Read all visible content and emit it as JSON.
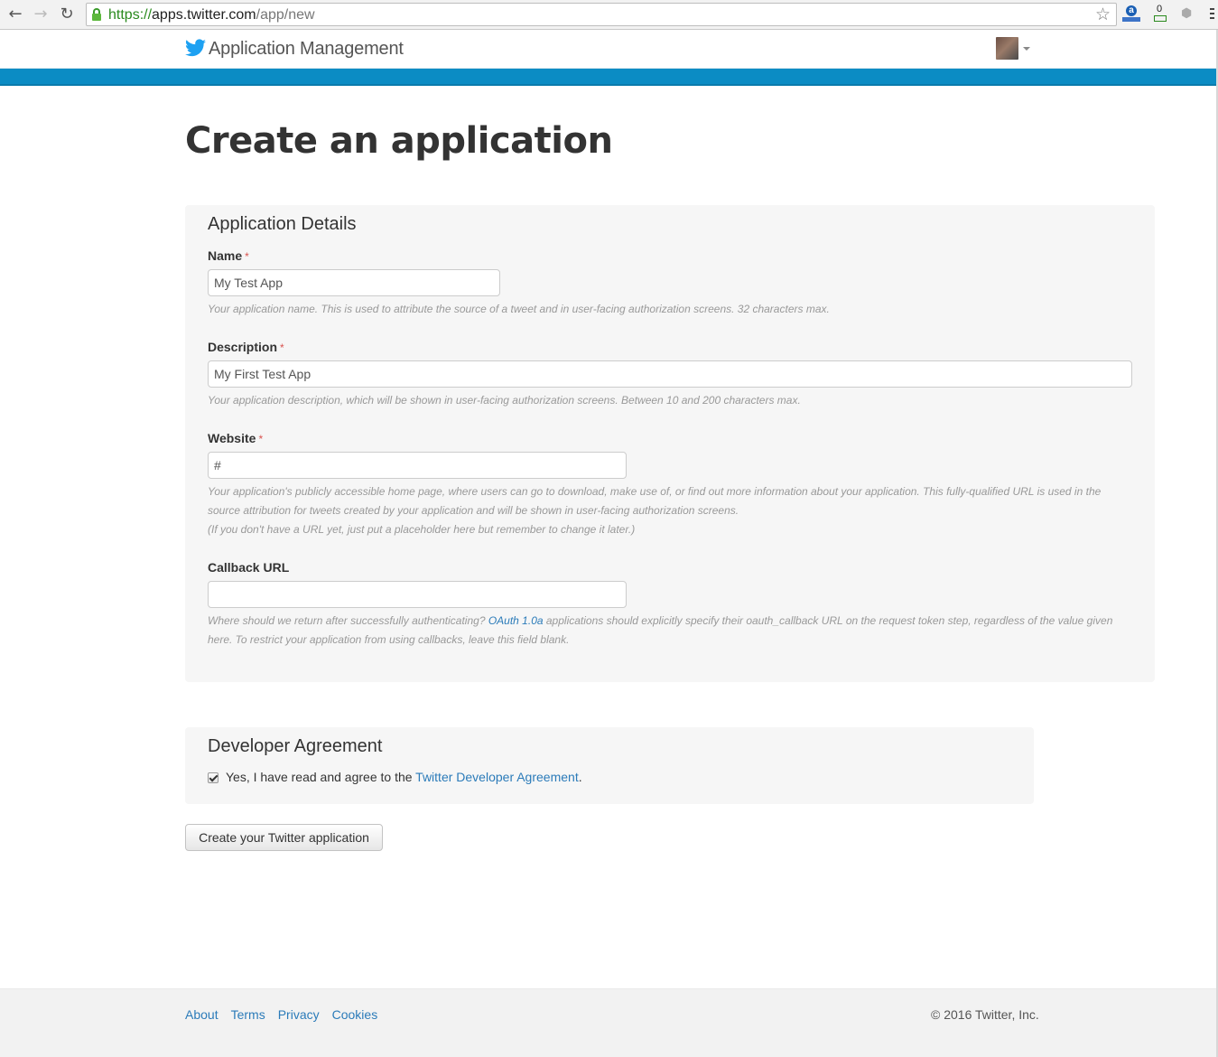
{
  "browser": {
    "url_scheme": "https://",
    "url_host": "apps.twitter.com",
    "url_path": "/app/new",
    "ext_counter_value": "0",
    "ext_amazon_letter": "a"
  },
  "header": {
    "brand": "Application Management",
    "brand_color": "#1da1f2",
    "bar_color": "#0b8cc4"
  },
  "page": {
    "title": "Create an application"
  },
  "details": {
    "heading": "Application Details",
    "required_marker": "*",
    "fields": {
      "name": {
        "label": "Name",
        "value": "My Test App",
        "help": "Your application name. This is used to attribute the source of a tweet and in user-facing authorization screens. 32 characters max."
      },
      "description": {
        "label": "Description",
        "value": "My First Test App",
        "help": "Your application description, which will be shown in user-facing authorization screens. Between 10 and 200 characters max."
      },
      "website": {
        "label": "Website",
        "value": "#",
        "help_line1": "Your application's publicly accessible home page, where users can go to download, make use of, or find out more information about your application. This fully-qualified URL is used in the",
        "help_line2": "source attribution for tweets created by your application and will be shown in user-facing authorization screens.",
        "help_line3": "(If you don't have a URL yet, just put a placeholder here but remember to change it later.)"
      },
      "callback": {
        "label": "Callback URL",
        "value": "",
        "help_before_link": "Where should we return after successfully authenticating? ",
        "help_link": "OAuth 1.0a",
        "help_after_link_line1": " applications should explicitly specify their oauth_callback URL on the request token step, regardless of the value given",
        "help_line2": "here. To restrict your application from using callbacks, leave this field blank."
      }
    }
  },
  "agreement": {
    "heading": "Developer Agreement",
    "checked": true,
    "text_before_link": "Yes, I have read and agree to the ",
    "link": "Twitter Developer Agreement",
    "text_after_link": "."
  },
  "submit_label": "Create your Twitter application",
  "footer": {
    "links": [
      "About",
      "Terms",
      "Privacy",
      "Cookies"
    ],
    "copyright": "© 2016 Twitter, Inc."
  }
}
